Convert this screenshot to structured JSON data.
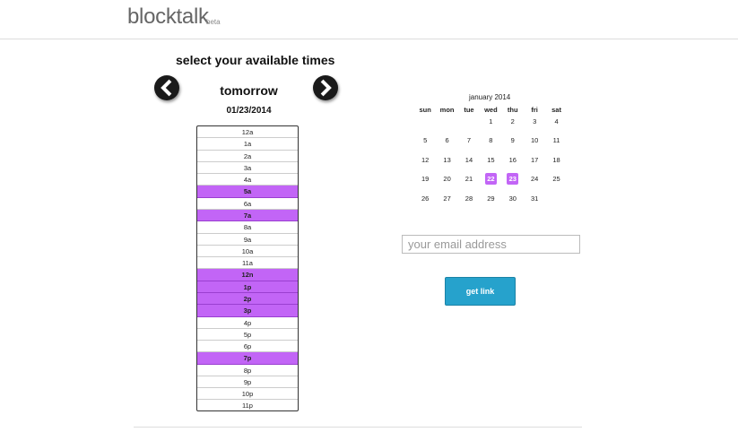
{
  "header": {
    "logo": "blocktalk",
    "badge": "beta"
  },
  "heading": "select your available times",
  "day_label": "tomorrow",
  "date_label": "01/23/2014",
  "slots": [
    {
      "label": "12a",
      "selected": false
    },
    {
      "label": "1a",
      "selected": false
    },
    {
      "label": "2a",
      "selected": false
    },
    {
      "label": "3a",
      "selected": false
    },
    {
      "label": "4a",
      "selected": false
    },
    {
      "label": "5a",
      "selected": true
    },
    {
      "label": "6a",
      "selected": false
    },
    {
      "label": "7a",
      "selected": true
    },
    {
      "label": "8a",
      "selected": false
    },
    {
      "label": "9a",
      "selected": false
    },
    {
      "label": "10a",
      "selected": false
    },
    {
      "label": "11a",
      "selected": false
    },
    {
      "label": "12n",
      "selected": true
    },
    {
      "label": "1p",
      "selected": true
    },
    {
      "label": "2p",
      "selected": true
    },
    {
      "label": "3p",
      "selected": true
    },
    {
      "label": "4p",
      "selected": false
    },
    {
      "label": "5p",
      "selected": false
    },
    {
      "label": "6p",
      "selected": false
    },
    {
      "label": "7p",
      "selected": true
    },
    {
      "label": "8p",
      "selected": false
    },
    {
      "label": "9p",
      "selected": false
    },
    {
      "label": "10p",
      "selected": false
    },
    {
      "label": "11p",
      "selected": false
    }
  ],
  "calendar": {
    "title": "january 2014",
    "weekdays": [
      "sun",
      "mon",
      "tue",
      "wed",
      "thu",
      "fri",
      "sat"
    ],
    "weeks": [
      [
        "",
        "",
        "",
        "1",
        "2",
        "3",
        "4"
      ],
      [
        "5",
        "6",
        "7",
        "8",
        "9",
        "10",
        "11"
      ],
      [
        "12",
        "13",
        "14",
        "15",
        "16",
        "17",
        "18"
      ],
      [
        "19",
        "20",
        "21",
        "22",
        "23",
        "24",
        "25"
      ],
      [
        "26",
        "27",
        "28",
        "29",
        "30",
        "31",
        ""
      ]
    ],
    "selected": [
      "22",
      "23"
    ]
  },
  "email": {
    "placeholder": "your email address",
    "value": ""
  },
  "submit_label": "get link",
  "colors": {
    "selected": "#c265f6",
    "button": "#26a2cc"
  },
  "icons": {
    "prev": "chevron-left-icon",
    "next": "chevron-right-icon"
  }
}
